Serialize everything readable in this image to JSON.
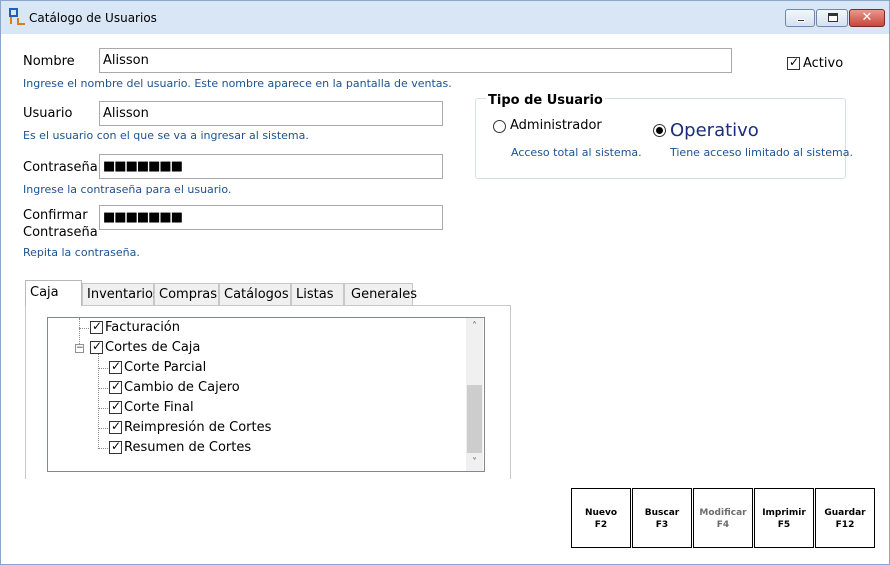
{
  "window": {
    "title": "Catálogo de Usuarios",
    "controls": {
      "minimize": "minimize",
      "maximize": "maximize",
      "close": "✕"
    }
  },
  "form": {
    "nombre": {
      "label": "Nombre",
      "value": "Alisson",
      "hint": "Ingrese el nombre del usuario. Este nombre aparece en la pantalla de ventas."
    },
    "usuario": {
      "label": "Usuario",
      "value": "Alisson",
      "hint": "Es el usuario con el que se va a ingresar al sistema."
    },
    "contrasena": {
      "label": "Contraseña",
      "value": "■■■■■■■",
      "hint": "Ingrese la contraseña para el usuario."
    },
    "confirmar": {
      "label_line1": "Confirmar",
      "label_line2": "Contraseña",
      "value": "■■■■■■■",
      "hint": "Repita la contraseña."
    },
    "activo": {
      "label": "Activo",
      "checked": true
    }
  },
  "tipo_usuario": {
    "title": "Tipo de Usuario",
    "options": [
      {
        "label": "Administrador",
        "description": "Acceso total al sistema.",
        "selected": false
      },
      {
        "label": "Operativo",
        "description": "Tiene acceso limitado al sistema.",
        "selected": true
      }
    ]
  },
  "tabs": [
    "Caja",
    "Inventarios",
    "Compras",
    "Catálogos",
    "Listas",
    "Generales"
  ],
  "active_tab": "Caja",
  "tree": {
    "items": [
      {
        "label": "Facturación",
        "checked": true,
        "level": 1
      },
      {
        "label": "Cortes de Caja",
        "checked": true,
        "level": 1,
        "expanded": true
      },
      {
        "label": "Corte Parcial",
        "checked": true,
        "level": 2
      },
      {
        "label": "Cambio de Cajero",
        "checked": true,
        "level": 2
      },
      {
        "label": "Corte Final",
        "checked": true,
        "level": 2
      },
      {
        "label": "Reimpresión de Cortes",
        "checked": true,
        "level": 2
      },
      {
        "label": "Resumen de Cortes",
        "checked": true,
        "level": 2
      }
    ]
  },
  "actions": [
    {
      "label": "Nuevo",
      "key": "F2",
      "enabled": true
    },
    {
      "label": "Buscar",
      "key": "F3",
      "enabled": true
    },
    {
      "label": "Modificar",
      "key": "F4",
      "enabled": false
    },
    {
      "label": "Imprimir",
      "key": "F5",
      "enabled": true
    },
    {
      "label": "Guardar",
      "key": "F12",
      "enabled": true
    }
  ],
  "colors": {
    "hint_text": "#1c5290",
    "operativo_text": "#1a2f7a",
    "titlebar": "#d9e6f6"
  }
}
